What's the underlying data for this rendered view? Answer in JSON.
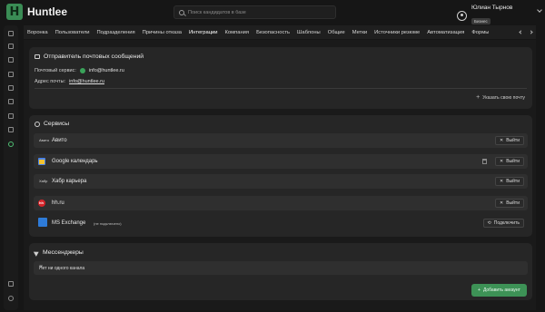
{
  "app": {
    "logo_letter": "H",
    "name": "Huntlee"
  },
  "search": {
    "placeholder": "Поиск кандидатов в базе"
  },
  "user": {
    "name": "Юлиан Тырнов",
    "badge": "Бизнес"
  },
  "tabs": [
    "Воронка",
    "Пользователи",
    "Подразделения",
    "Причины отказа",
    "Интеграции",
    "Компания",
    "Безопасность",
    "Шаблоны",
    "Общие",
    "Метки",
    "Источники резюме",
    "Автоматизация",
    "Формы"
  ],
  "mail_card": {
    "title": "Отправитель почтовых сообщений",
    "service_label": "Почтовый сервис:",
    "service_value": "info@huntlee.ru",
    "address_label": "Адрес почты:",
    "address_value": "info@huntlee.ru",
    "add_label": "Указать свою почту"
  },
  "services_card": {
    "title": "Сервисы",
    "items": [
      {
        "logo": "Авито",
        "name": "Авито",
        "action": "Выйти"
      },
      {
        "logo": "",
        "name": "Google календарь",
        "action": "Выйти"
      },
      {
        "logo": "Хабр",
        "name": "Хабр карьера",
        "action": "Выйти"
      },
      {
        "logo": "hh",
        "name": "hh.ru",
        "action": "Выйти"
      },
      {
        "logo": "",
        "name": "MS Exchange",
        "note": "(не подключено)",
        "action": "Подключить"
      }
    ]
  },
  "messengers_card": {
    "title": "Мессенджеры",
    "empty": "Нет ни одного канала",
    "add_label": "Добавить аккаунт"
  },
  "colors": {
    "accent": "#3d9256",
    "bg": "#161616",
    "card": "#262626"
  }
}
